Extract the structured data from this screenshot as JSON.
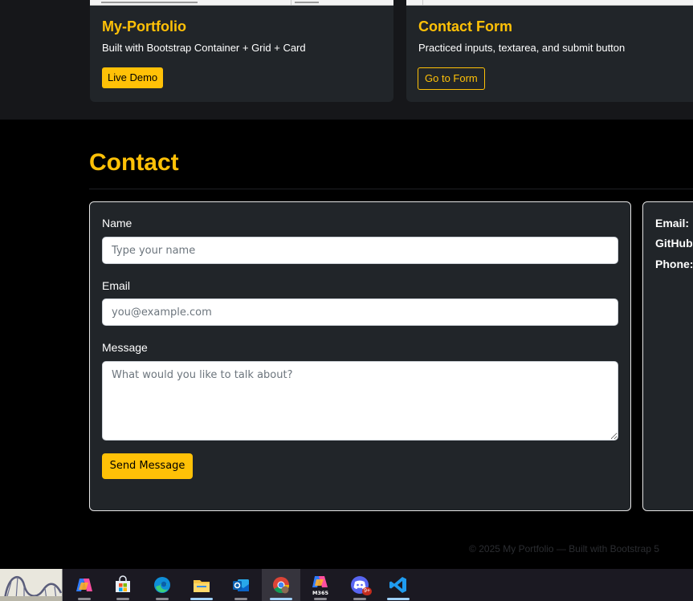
{
  "projects": [
    {
      "title": "My-Portfolio",
      "description": "Built with Bootstrap Container + Grid + Card",
      "button_label": "Live Demo"
    },
    {
      "title": "Contact Form",
      "description": "Practiced inputs, textarea, and submit button",
      "button_label": "Go to Form"
    }
  ],
  "contact": {
    "heading": "Contact",
    "form": {
      "name_label": "Name",
      "name_placeholder": "Type your name",
      "email_label": "Email",
      "email_placeholder": "you@example.com",
      "message_label": "Message",
      "message_placeholder": "What would you like to talk about?",
      "submit_label": "Send Message"
    },
    "info": {
      "email_label": "Email:",
      "github_label": "GitHub:",
      "phone_label": "Phone:"
    }
  },
  "footer": {
    "text": "© 2025 My Portfolio — Built with Bootstrap 5"
  },
  "taskbar": {
    "badge_count": "9+",
    "m365_label": "M365",
    "apps": [
      "copilot-icon",
      "microsoft-store-icon",
      "edge-icon",
      "file-explorer-icon",
      "outlook-icon",
      "chrome-icon",
      "m365-copilot-icon",
      "discord-icon",
      "vscode-icon"
    ]
  },
  "colors": {
    "accent": "#ffc107",
    "card_bg": "#212529",
    "page_bg": "#000000",
    "band_bg": "#16171a",
    "taskbar_bg": "#1b1922"
  }
}
